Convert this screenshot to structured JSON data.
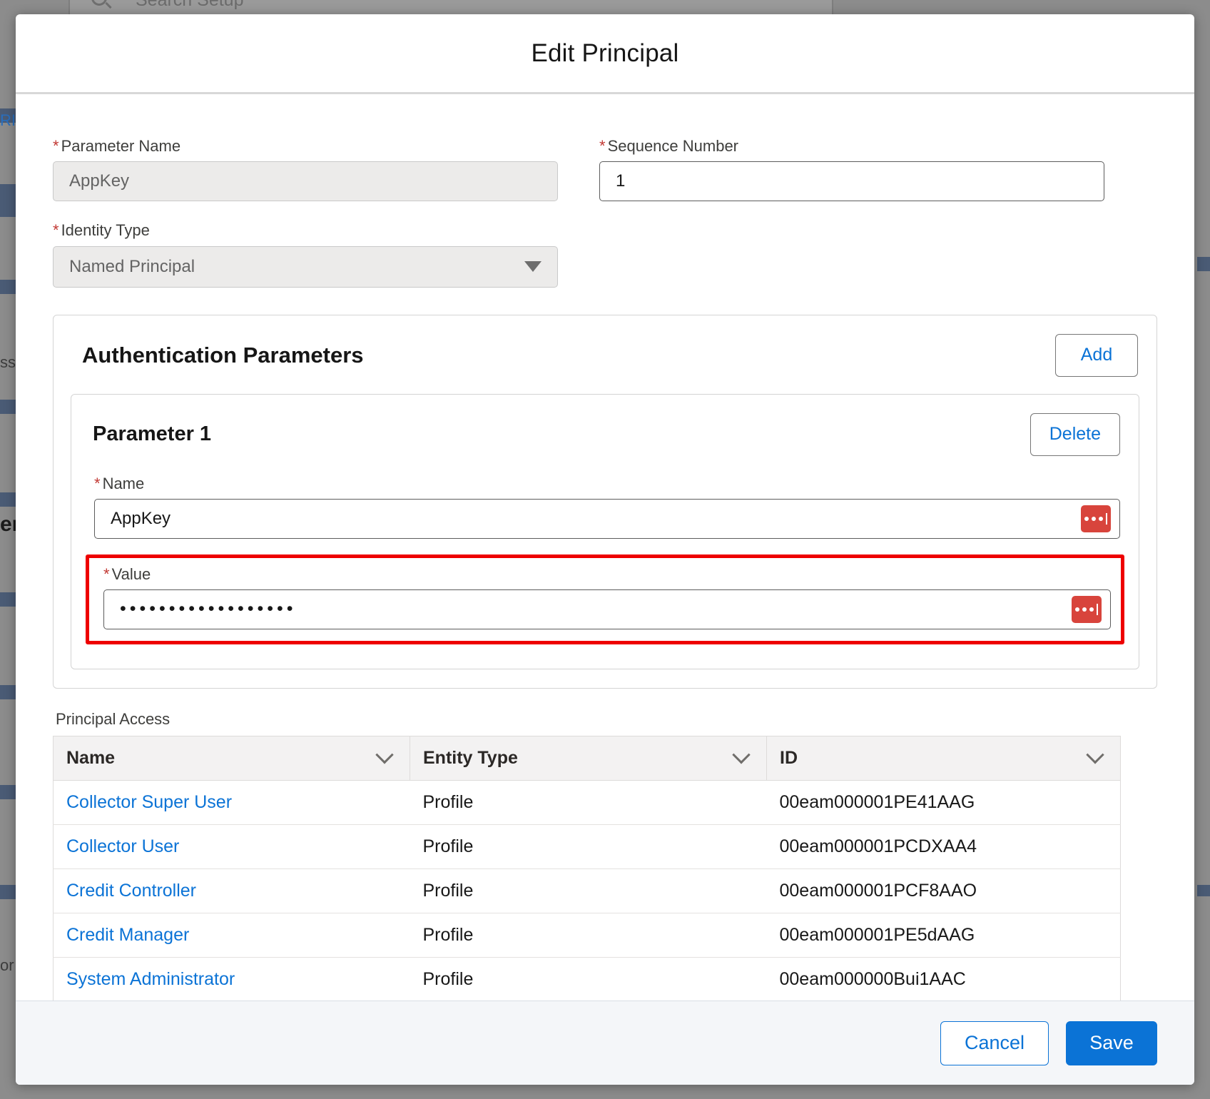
{
  "background": {
    "search_placeholder": "Search Setup",
    "search_icon": "search-icon",
    "fragment_left_1": "RI",
    "fragment_left_2": "ss",
    "fragment_left_3": "er",
    "fragment_left_4": "or"
  },
  "modal": {
    "title": "Edit Principal",
    "parameter_name": {
      "label": "Parameter Name",
      "required": "*",
      "value": "AppKey",
      "disabled": true
    },
    "sequence_number": {
      "label": "Sequence Number",
      "required": "*",
      "value": "1",
      "disabled": false
    },
    "identity_type": {
      "label": "Identity Type",
      "required": "*",
      "value": "Named Principal",
      "icon": "chevron-down-icon",
      "disabled": true
    },
    "auth_params": {
      "title": "Authentication Parameters",
      "add_label": "Add",
      "parameter": {
        "title": "Parameter 1",
        "delete_label": "Delete",
        "name_field": {
          "label": "Name",
          "required": "*",
          "value": "AppKey",
          "badge_icon": "password-manager-icon"
        },
        "value_field": {
          "label": "Value",
          "required": "*",
          "value": "••••••••••••••••••",
          "badge_icon": "password-manager-icon",
          "highlighted": true,
          "highlight_color": "#ee0000"
        }
      }
    },
    "principal_access": {
      "label": "Principal Access",
      "columns": [
        {
          "label": "Name",
          "sort_icon": "chevron-down-icon"
        },
        {
          "label": "Entity Type",
          "sort_icon": "chevron-down-icon"
        },
        {
          "label": "ID",
          "sort_icon": "chevron-down-icon"
        }
      ],
      "rows": [
        {
          "name": "Collector Super User",
          "entity_type": "Profile",
          "id": "00eam000001PE41AAG"
        },
        {
          "name": "Collector User",
          "entity_type": "Profile",
          "id": "00eam000001PCDXAA4"
        },
        {
          "name": "Credit Controller",
          "entity_type": "Profile",
          "id": "00eam000001PCF8AAO"
        },
        {
          "name": "Credit Manager",
          "entity_type": "Profile",
          "id": "00eam000001PE5dAAG"
        },
        {
          "name": "System Administrator",
          "entity_type": "Profile",
          "id": "00eam000000Bui1AAC"
        }
      ]
    },
    "footer": {
      "cancel_label": "Cancel",
      "save_label": "Save"
    }
  },
  "colors": {
    "accent_blue": "#0b73d6",
    "required_red": "#c23934",
    "annotation_red": "#ee0000",
    "badge_red": "#d8443c"
  }
}
